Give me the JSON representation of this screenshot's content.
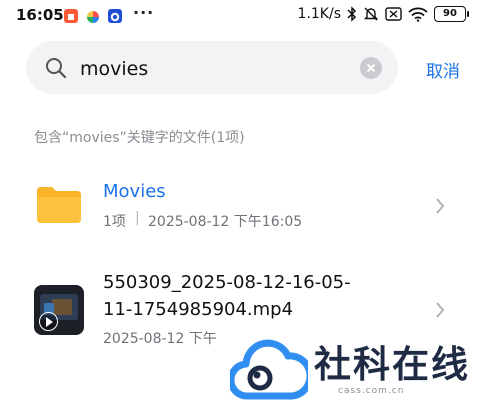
{
  "status_bar": {
    "time": "16:05",
    "net_speed": "1.1K/s",
    "battery": "90",
    "notif_icons": [
      "app-square-icon",
      "pinwheel-icon",
      "blue-ring-icon"
    ]
  },
  "search": {
    "value": "movies",
    "cancel_label": "取消"
  },
  "results": {
    "header": "包含“movies”关键字的文件(1项)",
    "items": [
      {
        "title": "Movies",
        "count": "1项",
        "date": "2025-08-12 下午16:05",
        "icon": "folder-icon"
      },
      {
        "title_line1": "550309_2025-08-12-16-05-",
        "title_line2": "11-1754985904.mp4",
        "meta": "2025-08-12 下午",
        "icon": "video-thumbnail"
      }
    ]
  },
  "watermark": {
    "text": "社科在线",
    "sub": "cass.com.cn"
  },
  "colors": {
    "accent": "#1a73e8",
    "folder": "#f9b427",
    "secondary_text": "#8a8d93"
  }
}
